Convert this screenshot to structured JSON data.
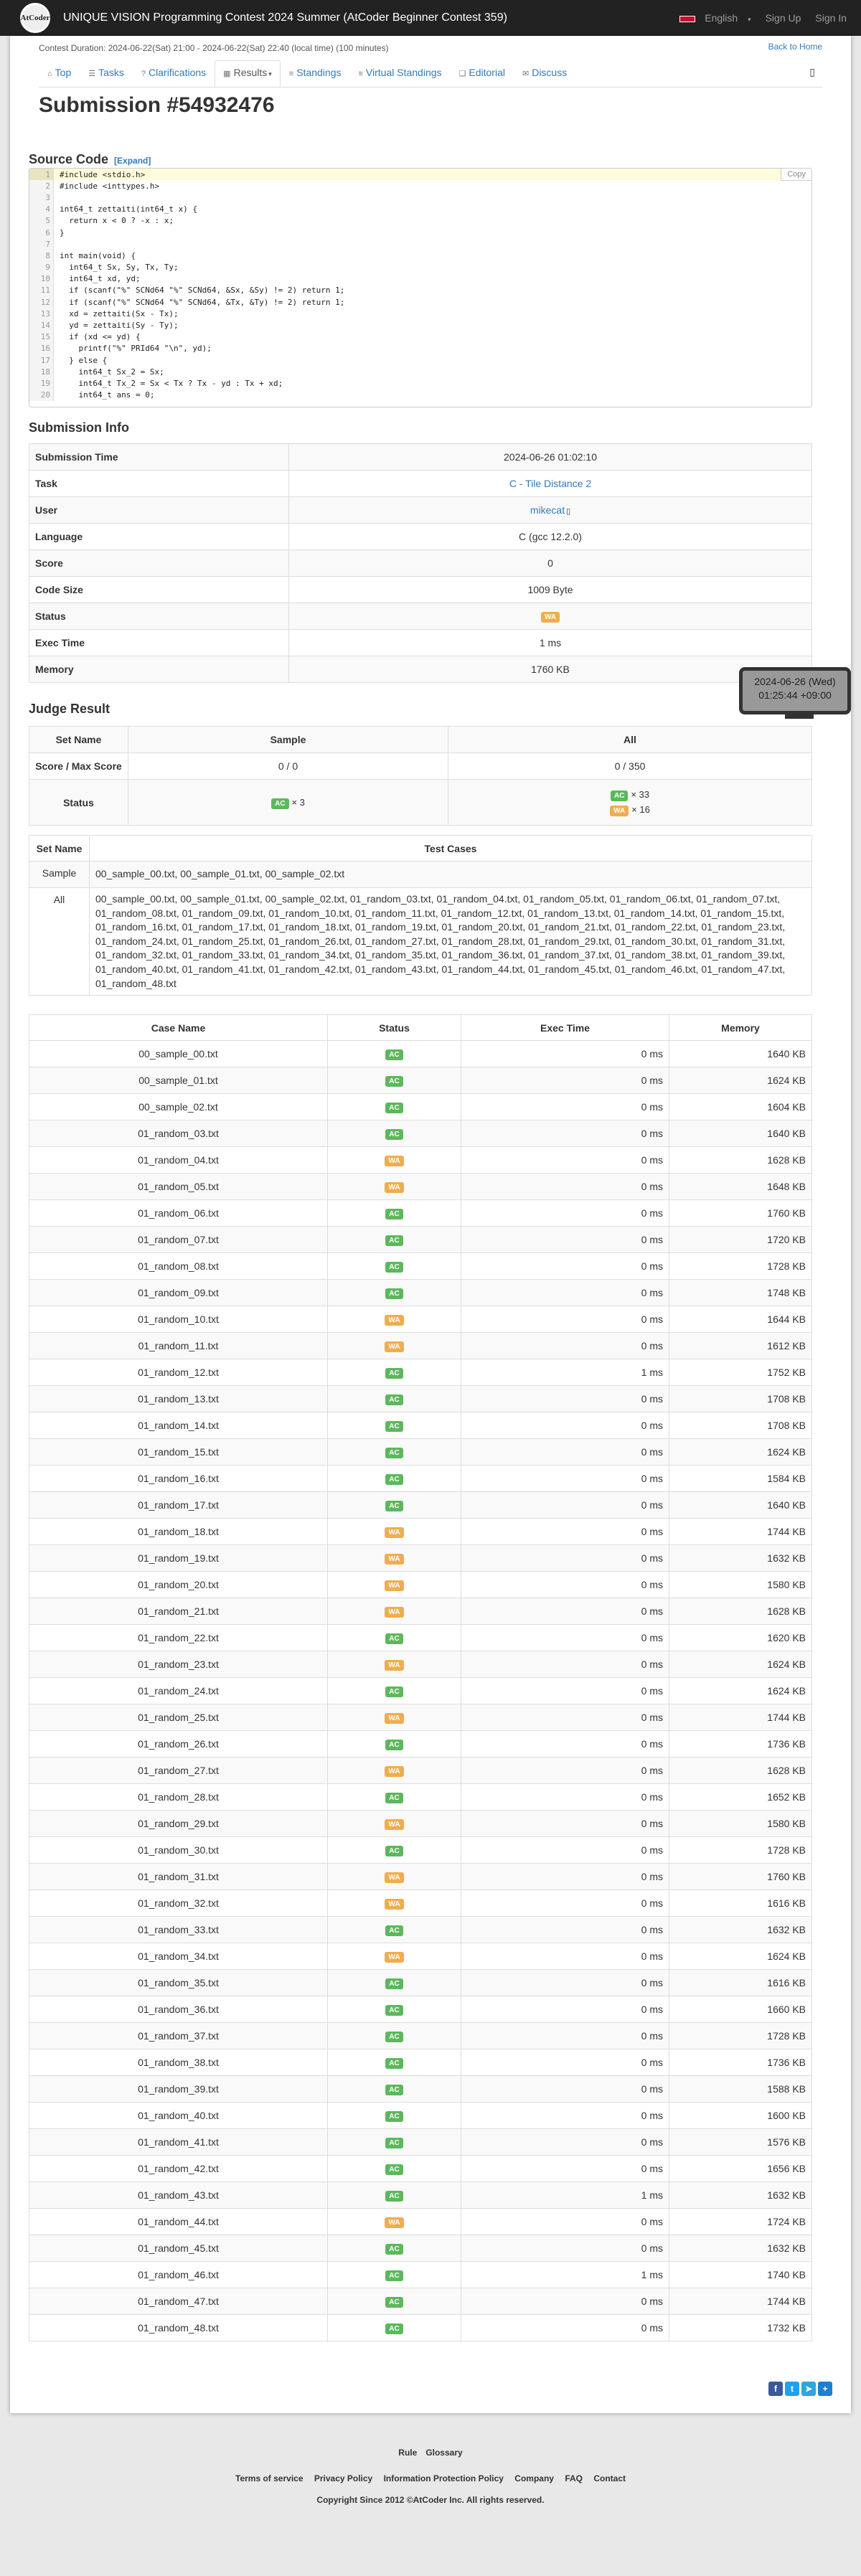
{
  "header": {
    "logo_text": "AtCoder",
    "contest_title": "UNIQUE VISION Programming Contest 2024 Summer (AtCoder Beginner Contest 359)",
    "language": "English",
    "sign_up": "Sign Up",
    "sign_in": "Sign In"
  },
  "contest": {
    "duration": "Contest Duration: 2024-06-22(Sat) 21:00 - 2024-06-22(Sat) 22:40 (local time) (100 minutes)",
    "back_home": "Back to Home"
  },
  "tabs": [
    {
      "label": "Top"
    },
    {
      "label": "Tasks"
    },
    {
      "label": "Clarifications"
    },
    {
      "label": "Results"
    },
    {
      "label": "Standings"
    },
    {
      "label": "Virtual Standings"
    },
    {
      "label": "Editorial"
    },
    {
      "label": "Discuss"
    }
  ],
  "page_title": "Submission #54932476",
  "source": {
    "heading": "Source Code",
    "expand": "[Expand]",
    "copy": "Copy",
    "lines": [
      "#include <stdio.h>",
      "#include <inttypes.h>",
      "",
      "int64_t zettaiti(int64_t x) {",
      "  return x < 0 ? -x : x;",
      "}",
      "",
      "int main(void) {",
      "  int64_t Sx, Sy, Tx, Ty;",
      "  int64_t xd, yd;",
      "  if (scanf(\"%\" SCNd64 \"%\" SCNd64, &Sx, &Sy) != 2) return 1;",
      "  if (scanf(\"%\" SCNd64 \"%\" SCNd64, &Tx, &Ty) != 2) return 1;",
      "  xd = zettaiti(Sx - Tx);",
      "  yd = zettaiti(Sy - Ty);",
      "  if (xd <= yd) {",
      "    printf(\"%\" PRId64 \"\\n\", yd);",
      "  } else {",
      "    int64_t Sx_2 = Sx;",
      "    int64_t Tx_2 = Sx < Tx ? Tx - yd : Tx + xd;",
      "    int64_t ans = 0;"
    ]
  },
  "info": {
    "heading": "Submission Info",
    "rows": [
      {
        "label": "Submission Time",
        "value": "2024-06-26 01:02:10"
      },
      {
        "label": "Task",
        "value": "C - Tile Distance 2"
      },
      {
        "label": "User",
        "value": "mikecat"
      },
      {
        "label": "Language",
        "value": "C (gcc 12.2.0)"
      },
      {
        "label": "Score",
        "value": "0"
      },
      {
        "label": "Code Size",
        "value": "1009 Byte"
      },
      {
        "label": "Status",
        "value": "WA"
      },
      {
        "label": "Exec Time",
        "value": "1 ms"
      },
      {
        "label": "Memory",
        "value": "1760 KB"
      }
    ]
  },
  "tooltip": {
    "line1": "2024-06-26 (Wed)",
    "line2": "01:25:44 +09:00"
  },
  "judge": {
    "heading": "Judge Result",
    "col_set": "Set Name",
    "col_sample": "Sample",
    "col_all": "All",
    "row_score": "Score / Max Score",
    "sample_score": "0 / 0",
    "all_score": "0 / 350",
    "row_status": "Status",
    "sample_ac": "AC",
    "sample_ac_count": "× 3",
    "all_ac": "AC",
    "all_ac_count": "× 33",
    "all_wa": "WA",
    "all_wa_count": "× 16"
  },
  "testcase_sets": {
    "col_set": "Set Name",
    "col_cases": "Test Cases",
    "sample_name": "Sample",
    "sample_cases": "00_sample_00.txt, 00_sample_01.txt, 00_sample_02.txt",
    "all_name": "All",
    "all_cases": "00_sample_00.txt, 00_sample_01.txt, 00_sample_02.txt, 01_random_03.txt, 01_random_04.txt, 01_random_05.txt, 01_random_06.txt, 01_random_07.txt, 01_random_08.txt, 01_random_09.txt, 01_random_10.txt, 01_random_11.txt, 01_random_12.txt, 01_random_13.txt, 01_random_14.txt, 01_random_15.txt, 01_random_16.txt, 01_random_17.txt, 01_random_18.txt, 01_random_19.txt, 01_random_20.txt, 01_random_21.txt, 01_random_22.txt, 01_random_23.txt, 01_random_24.txt, 01_random_25.txt, 01_random_26.txt, 01_random_27.txt, 01_random_28.txt, 01_random_29.txt, 01_random_30.txt, 01_random_31.txt, 01_random_32.txt, 01_random_33.txt, 01_random_34.txt, 01_random_35.txt, 01_random_36.txt, 01_random_37.txt, 01_random_38.txt, 01_random_39.txt, 01_random_40.txt, 01_random_41.txt, 01_random_42.txt, 01_random_43.txt, 01_random_44.txt, 01_random_45.txt, 01_random_46.txt, 01_random_47.txt, 01_random_48.txt"
  },
  "cases": {
    "columns": [
      "Case Name",
      "Status",
      "Exec Time",
      "Memory"
    ],
    "rows": [
      {
        "name": "00_sample_00.txt",
        "status": "AC",
        "time": "0 ms",
        "mem": "1640 KB"
      },
      {
        "name": "00_sample_01.txt",
        "status": "AC",
        "time": "0 ms",
        "mem": "1624 KB"
      },
      {
        "name": "00_sample_02.txt",
        "status": "AC",
        "time": "0 ms",
        "mem": "1604 KB"
      },
      {
        "name": "01_random_03.txt",
        "status": "AC",
        "time": "0 ms",
        "mem": "1640 KB"
      },
      {
        "name": "01_random_04.txt",
        "status": "WA",
        "time": "0 ms",
        "mem": "1628 KB"
      },
      {
        "name": "01_random_05.txt",
        "status": "WA",
        "time": "0 ms",
        "mem": "1648 KB"
      },
      {
        "name": "01_random_06.txt",
        "status": "AC",
        "time": "0 ms",
        "mem": "1760 KB"
      },
      {
        "name": "01_random_07.txt",
        "status": "AC",
        "time": "0 ms",
        "mem": "1720 KB"
      },
      {
        "name": "01_random_08.txt",
        "status": "AC",
        "time": "0 ms",
        "mem": "1728 KB"
      },
      {
        "name": "01_random_09.txt",
        "status": "AC",
        "time": "0 ms",
        "mem": "1748 KB"
      },
      {
        "name": "01_random_10.txt",
        "status": "WA",
        "time": "0 ms",
        "mem": "1644 KB"
      },
      {
        "name": "01_random_11.txt",
        "status": "WA",
        "time": "0 ms",
        "mem": "1612 KB"
      },
      {
        "name": "01_random_12.txt",
        "status": "AC",
        "time": "1 ms",
        "mem": "1752 KB"
      },
      {
        "name": "01_random_13.txt",
        "status": "AC",
        "time": "0 ms",
        "mem": "1708 KB"
      },
      {
        "name": "01_random_14.txt",
        "status": "AC",
        "time": "0 ms",
        "mem": "1708 KB"
      },
      {
        "name": "01_random_15.txt",
        "status": "AC",
        "time": "0 ms",
        "mem": "1624 KB"
      },
      {
        "name": "01_random_16.txt",
        "status": "AC",
        "time": "0 ms",
        "mem": "1584 KB"
      },
      {
        "name": "01_random_17.txt",
        "status": "AC",
        "time": "0 ms",
        "mem": "1640 KB"
      },
      {
        "name": "01_random_18.txt",
        "status": "WA",
        "time": "0 ms",
        "mem": "1744 KB"
      },
      {
        "name": "01_random_19.txt",
        "status": "WA",
        "time": "0 ms",
        "mem": "1632 KB"
      },
      {
        "name": "01_random_20.txt",
        "status": "WA",
        "time": "0 ms",
        "mem": "1580 KB"
      },
      {
        "name": "01_random_21.txt",
        "status": "WA",
        "time": "0 ms",
        "mem": "1628 KB"
      },
      {
        "name": "01_random_22.txt",
        "status": "AC",
        "time": "0 ms",
        "mem": "1620 KB"
      },
      {
        "name": "01_random_23.txt",
        "status": "WA",
        "time": "0 ms",
        "mem": "1624 KB"
      },
      {
        "name": "01_random_24.txt",
        "status": "AC",
        "time": "0 ms",
        "mem": "1624 KB"
      },
      {
        "name": "01_random_25.txt",
        "status": "WA",
        "time": "0 ms",
        "mem": "1744 KB"
      },
      {
        "name": "01_random_26.txt",
        "status": "AC",
        "time": "0 ms",
        "mem": "1736 KB"
      },
      {
        "name": "01_random_27.txt",
        "status": "WA",
        "time": "0 ms",
        "mem": "1628 KB"
      },
      {
        "name": "01_random_28.txt",
        "status": "AC",
        "time": "0 ms",
        "mem": "1652 KB"
      },
      {
        "name": "01_random_29.txt",
        "status": "WA",
        "time": "0 ms",
        "mem": "1580 KB"
      },
      {
        "name": "01_random_30.txt",
        "status": "AC",
        "time": "0 ms",
        "mem": "1728 KB"
      },
      {
        "name": "01_random_31.txt",
        "status": "WA",
        "time": "0 ms",
        "mem": "1760 KB"
      },
      {
        "name": "01_random_32.txt",
        "status": "WA",
        "time": "0 ms",
        "mem": "1616 KB"
      },
      {
        "name": "01_random_33.txt",
        "status": "AC",
        "time": "0 ms",
        "mem": "1632 KB"
      },
      {
        "name": "01_random_34.txt",
        "status": "WA",
        "time": "0 ms",
        "mem": "1624 KB"
      },
      {
        "name": "01_random_35.txt",
        "status": "AC",
        "time": "0 ms",
        "mem": "1616 KB"
      },
      {
        "name": "01_random_36.txt",
        "status": "AC",
        "time": "0 ms",
        "mem": "1660 KB"
      },
      {
        "name": "01_random_37.txt",
        "status": "AC",
        "time": "0 ms",
        "mem": "1728 KB"
      },
      {
        "name": "01_random_38.txt",
        "status": "AC",
        "time": "0 ms",
        "mem": "1736 KB"
      },
      {
        "name": "01_random_39.txt",
        "status": "AC",
        "time": "0 ms",
        "mem": "1588 KB"
      },
      {
        "name": "01_random_40.txt",
        "status": "AC",
        "time": "0 ms",
        "mem": "1600 KB"
      },
      {
        "name": "01_random_41.txt",
        "status": "AC",
        "time": "0 ms",
        "mem": "1576 KB"
      },
      {
        "name": "01_random_42.txt",
        "status": "AC",
        "time": "0 ms",
        "mem": "1656 KB"
      },
      {
        "name": "01_random_43.txt",
        "status": "AC",
        "time": "1 ms",
        "mem": "1632 KB"
      },
      {
        "name": "01_random_44.txt",
        "status": "WA",
        "time": "0 ms",
        "mem": "1724 KB"
      },
      {
        "name": "01_random_45.txt",
        "status": "AC",
        "time": "0 ms",
        "mem": "1632 KB"
      },
      {
        "name": "01_random_46.txt",
        "status": "AC",
        "time": "1 ms",
        "mem": "1740 KB"
      },
      {
        "name": "01_random_47.txt",
        "status": "AC",
        "time": "0 ms",
        "mem": "1744 KB"
      },
      {
        "name": "01_random_48.txt",
        "status": "AC",
        "time": "0 ms",
        "mem": "1732 KB"
      }
    ]
  },
  "colors": {
    "ac": "#5cb85c",
    "wa": "#f0ad4e",
    "topbar": "#222222",
    "link": "#337ab7"
  },
  "footer": {
    "rule": "Rule",
    "glossary": "Glossary",
    "terms": "Terms of service",
    "privacy": "Privacy Policy",
    "info_policy": "Information Protection Policy",
    "company": "Company",
    "faq": "FAQ",
    "contact": "Contact",
    "copyright": "Copyright Since 2012 ©AtCoder Inc. All rights reserved."
  }
}
